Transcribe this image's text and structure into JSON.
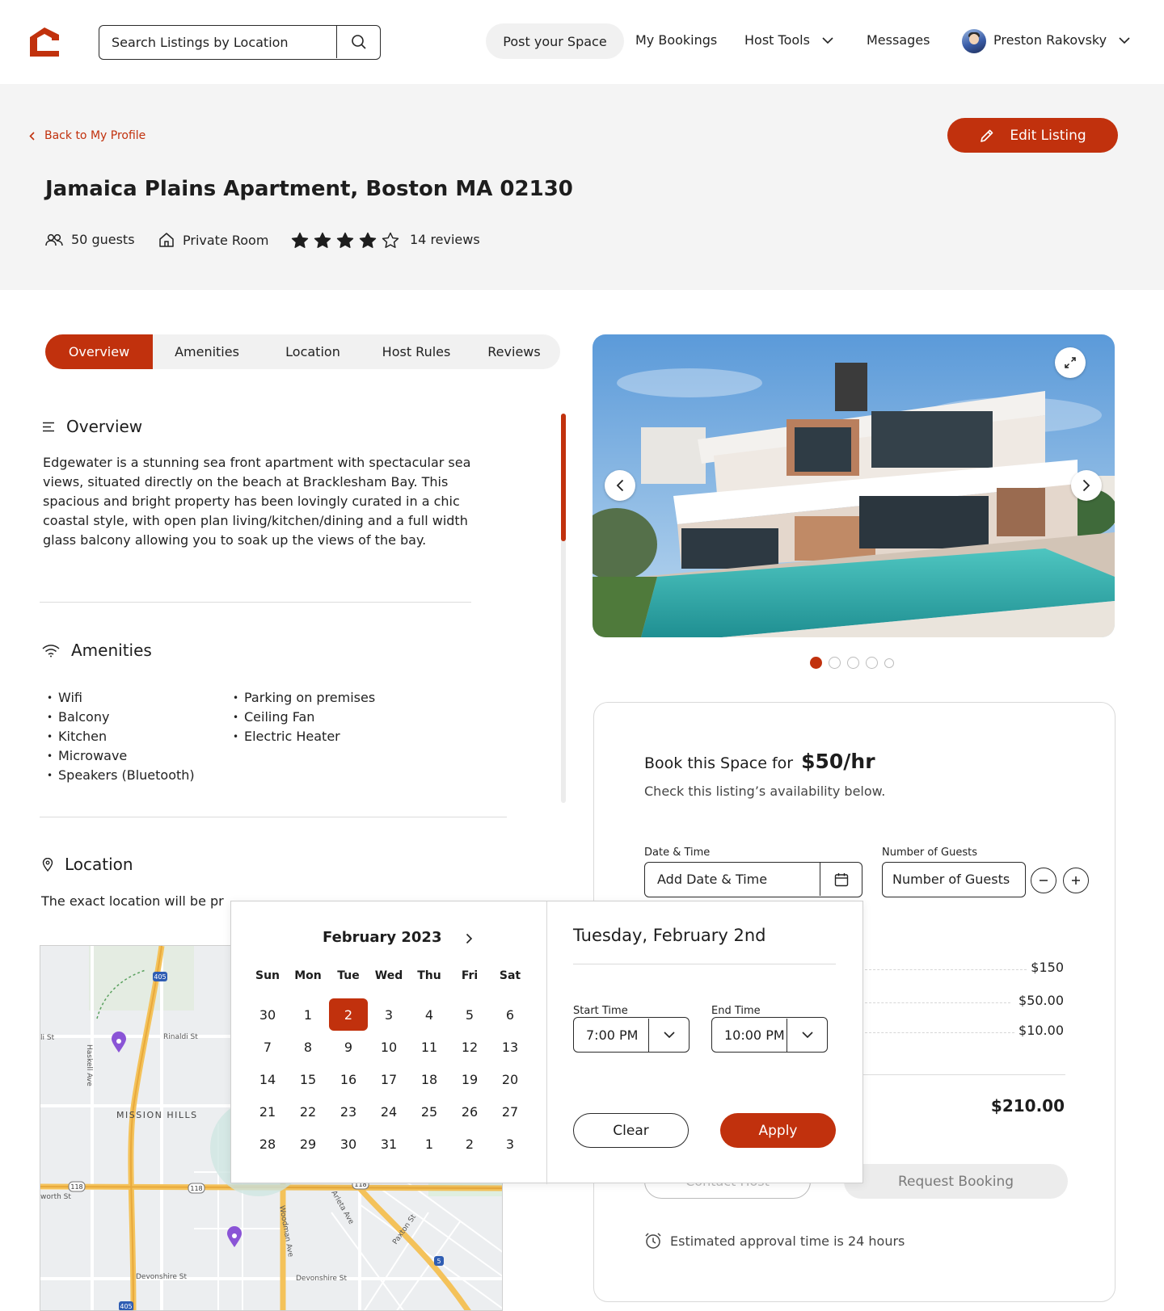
{
  "header": {
    "search_placeholder": "Search Listings by Location",
    "nav": {
      "post_space": "Post your Space",
      "my_bookings": "My Bookings",
      "host_tools": "Host Tools",
      "messages": "Messages",
      "user_name": "Preston Rakovsky"
    }
  },
  "hero": {
    "back_label": "Back to My Profile",
    "edit_label": "Edit Listing",
    "title": "Jamaica Plains Apartment, Boston MA 02130",
    "guests": "50 guests",
    "room_type": "Private Room",
    "rating": 4,
    "rating_max": 5,
    "reviews": "14 reviews"
  },
  "tabs": [
    "Overview",
    "Amenities",
    "Location",
    "Host Rules",
    "Reviews"
  ],
  "overview": {
    "heading": "Overview",
    "text": "Edgewater is a stunning sea front apartment with spectacular sea views, situated directly on the beach at Bracklesham Bay. This spacious and bright property has been lovingly curated in a chic coastal style, with open plan living/kitchen/dining and a full width glass balcony allowing you to soak up the views of the bay."
  },
  "amenities": {
    "heading": "Amenities",
    "col1": [
      "Wifi",
      "Balcony",
      "Kitchen",
      "Microwave",
      "Speakers (Bluetooth)"
    ],
    "col2": [
      "Parking on premises",
      "Ceiling Fan",
      "Electric Heater"
    ]
  },
  "location": {
    "heading": "Location",
    "text": "The exact location will be pr",
    "map_labels": {
      "rinaldi": "Rinaldi St",
      "li": "li St",
      "haskell": "Haskell Ave",
      "mission_hills": "MISSION HILLS",
      "worth": "worth St",
      "woodman": "Woodman Ave",
      "arleta": "Arleta Ave",
      "paxton": "Paxton St",
      "devonshire1": "Devonshire St",
      "devonshire2": "Devonshire St",
      "hwy405a": "405",
      "hwy405b": "405",
      "hwy118a": "118",
      "hwy118b": "118",
      "hwy118c": "118",
      "hwy5": "5"
    }
  },
  "gallery": {
    "slide_count": 5,
    "active_slide": 1
  },
  "booking": {
    "title_prefix": "Book this Space for",
    "price": "$50/hr",
    "subtitle": "Check this listing’s availability below.",
    "date_label": "Date & Time",
    "date_placeholder": "Add Date & Time",
    "guests_label": "Number of Guests",
    "guests_placeholder": "Number of Guests",
    "fees": [
      "$150",
      "$50.00",
      "$10.00"
    ],
    "total": "$210.00",
    "contact_label": "Contact Host",
    "request_label": "Request Booking",
    "approval": "Estimated approval time is 24 hours"
  },
  "datepicker": {
    "month": "February 2023",
    "weekdays": [
      "Sun",
      "Mon",
      "Tue",
      "Wed",
      "Thu",
      "Fri",
      "Sat"
    ],
    "days": [
      "30",
      "1",
      "2",
      "3",
      "4",
      "5",
      "6",
      "7",
      "8",
      "9",
      "10",
      "11",
      "12",
      "13",
      "14",
      "15",
      "16",
      "17",
      "18",
      "19",
      "20",
      "21",
      "22",
      "23",
      "24",
      "25",
      "26",
      "27",
      "28",
      "29",
      "30",
      "31",
      "1",
      "2",
      "3"
    ],
    "selected_index": 2,
    "selected_date": "Tuesday, February 2nd",
    "start_label": "Start Time",
    "start_value": "7:00 PM",
    "end_label": "End Time",
    "end_value": "10:00 PM",
    "clear_label": "Clear",
    "apply_label": "Apply"
  },
  "colors": {
    "accent": "#c1310d",
    "hero_bg": "#f4f4f4",
    "pill_bg": "#f1f1f1"
  }
}
